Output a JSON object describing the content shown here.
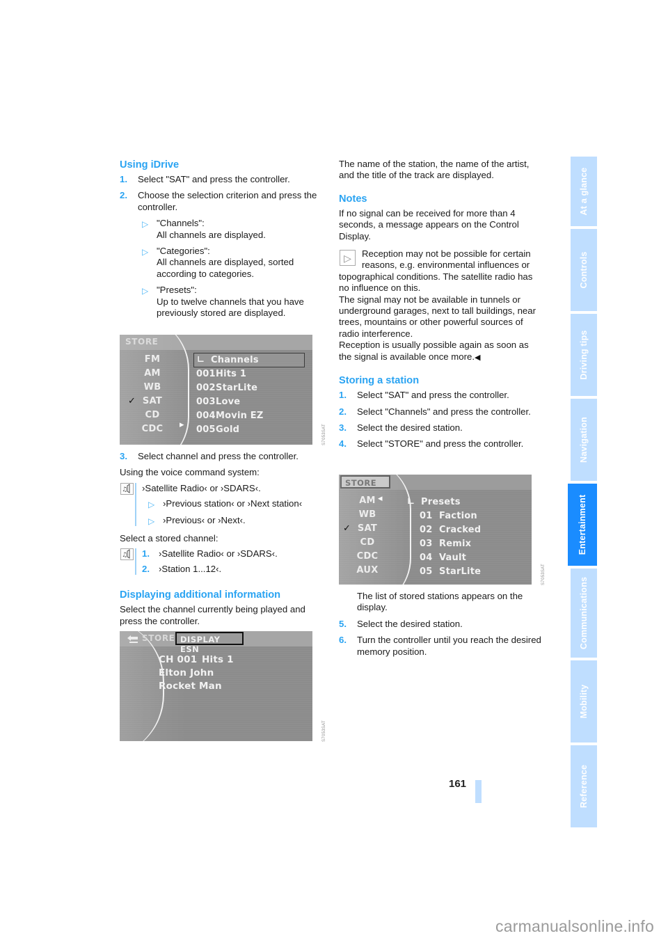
{
  "page": {
    "number": "161",
    "footer_watermark": "carmanualsonline.info"
  },
  "tabs": [
    {
      "label": "At a glance",
      "active": false
    },
    {
      "label": "Controls",
      "active": false
    },
    {
      "label": "Driving tips",
      "active": false
    },
    {
      "label": "Navigation",
      "active": false
    },
    {
      "label": "Entertainment",
      "active": true
    },
    {
      "label": "Communications",
      "active": false
    },
    {
      "label": "Mobility",
      "active": false
    },
    {
      "label": "Reference",
      "active": false
    }
  ],
  "colors": {
    "heading_blue": "#29a3f2",
    "tab_inactive": "#bfdeff",
    "tab_active": "#1a8cff",
    "rule_blue": "#bfdeff"
  },
  "left_column": {
    "heading_using_idrive": "Using iDrive",
    "step1_num": "1.",
    "step1_text": "Select \"SAT\" and press the controller.",
    "step2_num": "2.",
    "step2_text": "Choose the selection criterion and press the controller.",
    "bullets": [
      {
        "title": "\"Channels\":",
        "text": "All channels are displayed."
      },
      {
        "title": "\"Categories\":",
        "text": "All channels are displayed, sorted according to categories."
      },
      {
        "title": "\"Presets\":",
        "text": "Up to twelve channels that you have previously stored are displayed."
      }
    ],
    "step3_num": "3.",
    "step3_text": "Select channel and press the controller.",
    "voice_intro": "Using the voice command system:",
    "voice_main": "›Satellite Radio‹ or ›SDARS‹.",
    "voice_bullets": [
      "›Previous station‹ or ›Next station‹",
      "›Previous‹ or ›Next‹."
    ],
    "stored_intro": "Select a stored channel:",
    "stored_steps": [
      {
        "num": "1.",
        "text": "›Satellite Radio‹ or ›SDARS‹."
      },
      {
        "num": "2.",
        "text": "›Station 1...12‹."
      }
    ],
    "heading_displaying": "Displaying additional information",
    "displaying_text": "Select the channel currently being played and press the controller."
  },
  "right_column": {
    "intro_text": "The name of the station, the name of the artist, and the title of the track are displayed.",
    "heading_notes": "Notes",
    "notes_p1": "If no signal can be received for more than 4 seconds, a message appears on the Control Display.",
    "notes_icon_text": "Reception may not be possible for certain reasons, e.g. environmental influences or",
    "notes_p2": "topographical conditions. The satellite radio has no influence on this.",
    "notes_p3": "The signal may not be available in tunnels or underground garages, next to tall buildings, near trees, mountains or other powerful sources of radio interference.",
    "notes_p4": "Reception is usually possible again as soon as the signal is available once more.",
    "notes_endmark": "◀",
    "heading_storing": "Storing a station",
    "storing_steps": [
      {
        "num": "1.",
        "text": "Select \"SAT\" and press the controller."
      },
      {
        "num": "2.",
        "text": "Select \"Channels\" and press the controller."
      },
      {
        "num": "3.",
        "text": "Select the desired station."
      },
      {
        "num": "4.",
        "text": "Select \"STORE\" and press the controller."
      }
    ],
    "after_image_text": "The list of stored stations appears on the display.",
    "storing_steps_2": [
      {
        "num": "5.",
        "text": "Select the desired station."
      },
      {
        "num": "6.",
        "text": "Turn the controller until you reach the desired memory position."
      }
    ]
  },
  "screens": {
    "channels_list": {
      "header_store": "STORE",
      "left_menu": [
        {
          "label": "FM",
          "checked": false
        },
        {
          "label": "AM",
          "checked": false
        },
        {
          "label": "WB",
          "checked": false
        },
        {
          "label": "SAT",
          "checked": true
        },
        {
          "label": "CD",
          "checked": false
        },
        {
          "label": "CDC",
          "checked": false
        }
      ],
      "list": [
        {
          "num": "",
          "label": "Channels",
          "selected": true,
          "updir": true
        },
        {
          "num": "001",
          "label": "Hits 1",
          "selected": false,
          "updir": false
        },
        {
          "num": "002",
          "label": "StarLite",
          "selected": false,
          "updir": false
        },
        {
          "num": "003",
          "label": "Love",
          "selected": false,
          "updir": false
        },
        {
          "num": "004",
          "label": "Movin EZ",
          "selected": false,
          "updir": false
        },
        {
          "num": "005",
          "label": "Gold",
          "selected": false,
          "updir": false
        }
      ],
      "ref_code": "S7053SAT"
    },
    "presets_list": {
      "header_store": "STORE",
      "left_menu": [
        {
          "label": "AM",
          "checked": false
        },
        {
          "label": "WB",
          "checked": false
        },
        {
          "label": "SAT",
          "checked": true
        },
        {
          "label": "CD",
          "checked": false
        },
        {
          "label": "CDC",
          "checked": false
        },
        {
          "label": "AUX",
          "checked": false
        }
      ],
      "list": [
        {
          "num": "",
          "label": "Presets",
          "selected": false,
          "updir": true
        },
        {
          "num": "01",
          "label": "Faction",
          "selected": false,
          "updir": false
        },
        {
          "num": "02",
          "label": "Cracked",
          "selected": false,
          "updir": false
        },
        {
          "num": "03",
          "label": "Remix",
          "selected": false,
          "updir": false
        },
        {
          "num": "04",
          "label": "Vault",
          "selected": false,
          "updir": false
        },
        {
          "num": "05",
          "label": "StarLite",
          "selected": false,
          "updir": false
        }
      ],
      "ref_code": "S7053SAT"
    },
    "esn_display": {
      "back_icon": "↩",
      "store_label": "STORE",
      "display_esn_label": "DISPLAY ESN",
      "channel_num": "CH 001",
      "channel_name": "Hits 1",
      "artist": "Elton John",
      "track": "Rocket Man",
      "ref_code": "S7053SAT"
    }
  }
}
